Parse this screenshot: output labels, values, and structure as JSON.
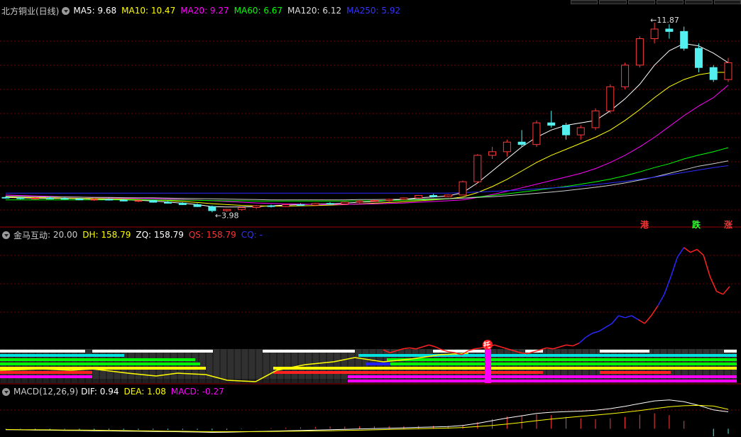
{
  "kline": {
    "name": "北方铜业(日线)",
    "ma_items": [
      {
        "label": "MA5: 9.68",
        "color": "#ffffff"
      },
      {
        "label": "MA10: 10.47",
        "color": "#ffff00"
      },
      {
        "label": "MA20: 9.27",
        "color": "#ff00ff"
      },
      {
        "label": "MA60: 6.67",
        "color": "#00ff00"
      },
      {
        "label": "MA120: 6.12",
        "color": "#dddddd"
      },
      {
        "label": "MA250: 5.92",
        "color": "#3333ff"
      }
    ],
    "high_label": "11.87",
    "low_label": "3.98",
    "tags": [
      {
        "text": "港",
        "color": "#ff3333"
      },
      {
        "text": "跌",
        "color": "#33ff33"
      },
      {
        "text": "涨",
        "color": "#ff3333"
      }
    ]
  },
  "indicator": {
    "name": "金马互动",
    "items": [
      {
        "label": ": 20.00",
        "color": "#cccccc"
      },
      {
        "label": "DH: 158.79",
        "color": "#ffff00"
      },
      {
        "label": "ZQ: 158.79",
        "color": "#ffffff"
      },
      {
        "label": "QS: 158.79",
        "color": "#ff3333"
      },
      {
        "label": "CQ: -",
        "color": "#3333ff"
      }
    ],
    "marker": "托"
  },
  "macd": {
    "name": "MACD(12,26,9)",
    "items": [
      {
        "label": "DIF: 0.94",
        "color": "#ffffff"
      },
      {
        "label": "DEA: 1.08",
        "color": "#ffff00"
      },
      {
        "label": "MACD: -0.27",
        "color": "#ff00ff"
      }
    ]
  },
  "chart_data": [
    {
      "type": "candlestick",
      "title": "北方铜业(日线)",
      "candles": [
        [
          4.6,
          4.65,
          4.55,
          4.58
        ],
        [
          4.58,
          4.62,
          4.52,
          4.55
        ],
        [
          4.55,
          4.6,
          4.5,
          4.57
        ],
        [
          4.57,
          4.63,
          4.53,
          4.56
        ],
        [
          4.56,
          4.6,
          4.5,
          4.54
        ],
        [
          4.54,
          4.58,
          4.48,
          4.5
        ],
        [
          4.5,
          4.56,
          4.46,
          4.52
        ],
        [
          4.52,
          4.57,
          4.47,
          4.49
        ],
        [
          4.49,
          4.53,
          4.43,
          4.45
        ],
        [
          4.45,
          4.5,
          4.4,
          4.47
        ],
        [
          4.47,
          4.5,
          4.38,
          4.4
        ],
        [
          4.4,
          4.45,
          4.34,
          4.36
        ],
        [
          4.36,
          4.4,
          4.28,
          4.3
        ],
        [
          4.3,
          4.35,
          4.2,
          4.22
        ],
        [
          4.22,
          4.26,
          3.98,
          4.05
        ],
        [
          4.05,
          4.12,
          4.0,
          4.1
        ],
        [
          4.1,
          4.2,
          4.05,
          4.18
        ],
        [
          4.18,
          4.28,
          4.12,
          4.25
        ],
        [
          4.25,
          4.3,
          4.18,
          4.22
        ],
        [
          4.22,
          4.32,
          4.2,
          4.3
        ],
        [
          4.3,
          4.36,
          4.25,
          4.28
        ],
        [
          4.28,
          4.38,
          4.24,
          4.35
        ],
        [
          4.35,
          4.4,
          4.3,
          4.33
        ],
        [
          4.33,
          4.42,
          4.3,
          4.4
        ],
        [
          4.4,
          4.48,
          4.36,
          4.45
        ],
        [
          4.45,
          4.5,
          4.4,
          4.47
        ],
        [
          4.47,
          4.55,
          4.42,
          4.52
        ],
        [
          4.52,
          4.6,
          4.48,
          4.58
        ],
        [
          4.58,
          4.7,
          4.55,
          4.68
        ],
        [
          4.68,
          4.75,
          4.6,
          4.63
        ],
        [
          4.63,
          4.72,
          4.6,
          4.7
        ],
        [
          4.7,
          5.3,
          4.68,
          5.25
        ],
        [
          5.25,
          6.4,
          5.2,
          6.35
        ],
        [
          6.35,
          6.7,
          6.2,
          6.5
        ],
        [
          6.5,
          7.0,
          6.3,
          6.9
        ],
        [
          6.9,
          7.4,
          6.7,
          6.8
        ],
        [
          6.8,
          7.8,
          6.7,
          7.7
        ],
        [
          7.7,
          8.2,
          7.5,
          7.6
        ],
        [
          7.6,
          7.7,
          7.0,
          7.2
        ],
        [
          7.2,
          7.6,
          7.0,
          7.5
        ],
        [
          7.5,
          8.3,
          7.4,
          8.2
        ],
        [
          8.2,
          9.3,
          8.1,
          9.2
        ],
        [
          9.2,
          10.2,
          9.1,
          10.1
        ],
        [
          10.1,
          11.3,
          10.0,
          11.2
        ],
        [
          11.2,
          11.87,
          11.0,
          11.6
        ],
        [
          11.6,
          11.8,
          11.2,
          11.5
        ],
        [
          11.5,
          11.7,
          10.7,
          10.8
        ],
        [
          10.8,
          11.0,
          9.8,
          10.0
        ],
        [
          10.0,
          10.1,
          9.4,
          9.5
        ],
        [
          9.5,
          10.4,
          9.4,
          10.2
        ]
      ],
      "ma": {
        "MA5": [
          4.6,
          4.58,
          4.57,
          4.56,
          4.56,
          4.55,
          4.53,
          4.51,
          4.5,
          4.48,
          4.45,
          4.41,
          4.36,
          4.3,
          4.22,
          4.2,
          4.2,
          4.22,
          4.25,
          4.28,
          4.3,
          4.32,
          4.33,
          4.36,
          4.4,
          4.43,
          4.47,
          4.52,
          4.58,
          4.62,
          4.66,
          4.8,
          5.2,
          5.7,
          6.2,
          6.7,
          7.1,
          7.4,
          7.6,
          7.7,
          7.8,
          8.2,
          8.7,
          9.3,
          10.1,
          10.7,
          11.0,
          10.9,
          10.6,
          10.2
        ],
        "MA10": [
          4.62,
          4.6,
          4.59,
          4.58,
          4.57,
          4.56,
          4.55,
          4.54,
          4.53,
          4.51,
          4.49,
          4.47,
          4.43,
          4.39,
          4.34,
          4.3,
          4.27,
          4.25,
          4.24,
          4.24,
          4.25,
          4.26,
          4.28,
          4.3,
          4.33,
          4.36,
          4.39,
          4.42,
          4.46,
          4.5,
          4.54,
          4.62,
          4.8,
          5.05,
          5.35,
          5.7,
          6.05,
          6.35,
          6.6,
          6.85,
          7.1,
          7.4,
          7.8,
          8.25,
          8.75,
          9.2,
          9.5,
          9.7,
          9.8,
          9.8
        ],
        "MA20": [
          4.7,
          4.68,
          4.66,
          4.64,
          4.62,
          4.61,
          4.6,
          4.58,
          4.57,
          4.56,
          4.55,
          4.53,
          4.51,
          4.49,
          4.46,
          4.43,
          4.4,
          4.37,
          4.35,
          4.33,
          4.32,
          4.31,
          4.31,
          4.31,
          4.32,
          4.33,
          4.35,
          4.37,
          4.4,
          4.43,
          4.46,
          4.5,
          4.6,
          4.72,
          4.86,
          5.0,
          5.15,
          5.3,
          5.45,
          5.6,
          5.8,
          6.05,
          6.35,
          6.7,
          7.1,
          7.55,
          8.0,
          8.4,
          8.75,
          9.27
        ],
        "MA60": [
          4.5,
          4.5,
          4.5,
          4.5,
          4.5,
          4.5,
          4.5,
          4.5,
          4.5,
          4.5,
          4.5,
          4.49,
          4.49,
          4.48,
          4.47,
          4.46,
          4.46,
          4.45,
          4.45,
          4.45,
          4.45,
          4.45,
          4.45,
          4.45,
          4.46,
          4.46,
          4.47,
          4.48,
          4.5,
          4.52,
          4.54,
          4.57,
          4.62,
          4.68,
          4.75,
          4.82,
          4.9,
          4.98,
          5.06,
          5.15,
          5.25,
          5.36,
          5.5,
          5.66,
          5.84,
          6.0,
          6.2,
          6.36,
          6.5,
          6.67
        ],
        "MA120": [
          4.65,
          4.64,
          4.63,
          4.62,
          4.62,
          4.61,
          4.6,
          4.6,
          4.59,
          4.58,
          4.58,
          4.57,
          4.56,
          4.55,
          4.54,
          4.53,
          4.52,
          4.51,
          4.5,
          4.5,
          4.5,
          4.5,
          4.5,
          4.5,
          4.51,
          4.51,
          4.52,
          4.52,
          4.53,
          4.54,
          4.55,
          4.57,
          4.6,
          4.63,
          4.67,
          4.72,
          4.77,
          4.82,
          4.88,
          4.95,
          5.02,
          5.1,
          5.2,
          5.32,
          5.45,
          5.6,
          5.75,
          5.9,
          6.0,
          6.12
        ],
        "MA250": [
          4.78,
          4.78,
          4.78,
          4.78,
          4.78,
          4.78,
          4.78,
          4.78,
          4.78,
          4.78,
          4.78,
          4.78,
          4.78,
          4.78,
          4.78,
          4.78,
          4.78,
          4.78,
          4.78,
          4.78,
          4.78,
          4.78,
          4.78,
          4.78,
          4.78,
          4.78,
          4.78,
          4.78,
          4.78,
          4.78,
          4.78,
          4.8,
          4.82,
          4.85,
          4.88,
          4.91,
          4.95,
          4.99,
          5.03,
          5.08,
          5.13,
          5.2,
          5.27,
          5.35,
          5.44,
          5.54,
          5.64,
          5.74,
          5.84,
          5.92
        ]
      }
    },
    {
      "type": "line",
      "title": "金马互动",
      "x_start": 35,
      "series": [
        {
          "name": "QS",
          "color_red": "#ff2020",
          "color_blue": "#2020ff",
          "values": [
            55,
            52,
            54,
            56,
            57,
            56,
            58,
            60,
            58,
            55,
            53,
            52,
            50,
            54,
            56,
            57,
            58,
            60,
            58,
            56,
            54,
            52,
            51,
            53,
            55,
            57,
            56,
            58,
            60,
            59,
            62,
            68,
            72,
            74,
            78,
            82,
            90,
            88,
            90,
            86,
            82,
            90,
            100,
            112,
            130,
            150,
            160,
            155,
            158,
            152,
            130,
            115,
            112,
            120
          ]
        }
      ]
    },
    {
      "type": "line",
      "title": "MACD(12,26,9)",
      "series": [
        {
          "name": "DIF",
          "values": [
            -0.05,
            -0.06,
            -0.07,
            -0.08,
            -0.09,
            -0.1,
            -0.11,
            -0.12,
            -0.13,
            -0.14,
            -0.15,
            -0.16,
            -0.17,
            -0.18,
            -0.2,
            -0.19,
            -0.17,
            -0.15,
            -0.13,
            -0.11,
            -0.09,
            -0.07,
            -0.05,
            -0.03,
            -0.01,
            0.01,
            0.03,
            0.05,
            0.08,
            0.1,
            0.12,
            0.18,
            0.3,
            0.45,
            0.6,
            0.72,
            0.85,
            0.92,
            0.95,
            0.98,
            1.03,
            1.12,
            1.25,
            1.4,
            1.55,
            1.6,
            1.5,
            1.3,
            1.05,
            0.94
          ]
        },
        {
          "name": "DEA",
          "values": [
            -0.04,
            -0.05,
            -0.05,
            -0.06,
            -0.07,
            -0.07,
            -0.08,
            -0.09,
            -0.1,
            -0.11,
            -0.12,
            -0.13,
            -0.14,
            -0.15,
            -0.16,
            -0.16,
            -0.16,
            -0.16,
            -0.15,
            -0.14,
            -0.13,
            -0.12,
            -0.11,
            -0.09,
            -0.08,
            -0.06,
            -0.04,
            -0.02,
            0.0,
            0.02,
            0.04,
            0.07,
            0.12,
            0.18,
            0.26,
            0.35,
            0.45,
            0.54,
            0.62,
            0.69,
            0.76,
            0.83,
            0.92,
            1.01,
            1.12,
            1.22,
            1.28,
            1.3,
            1.26,
            1.08
          ]
        }
      ]
    }
  ]
}
